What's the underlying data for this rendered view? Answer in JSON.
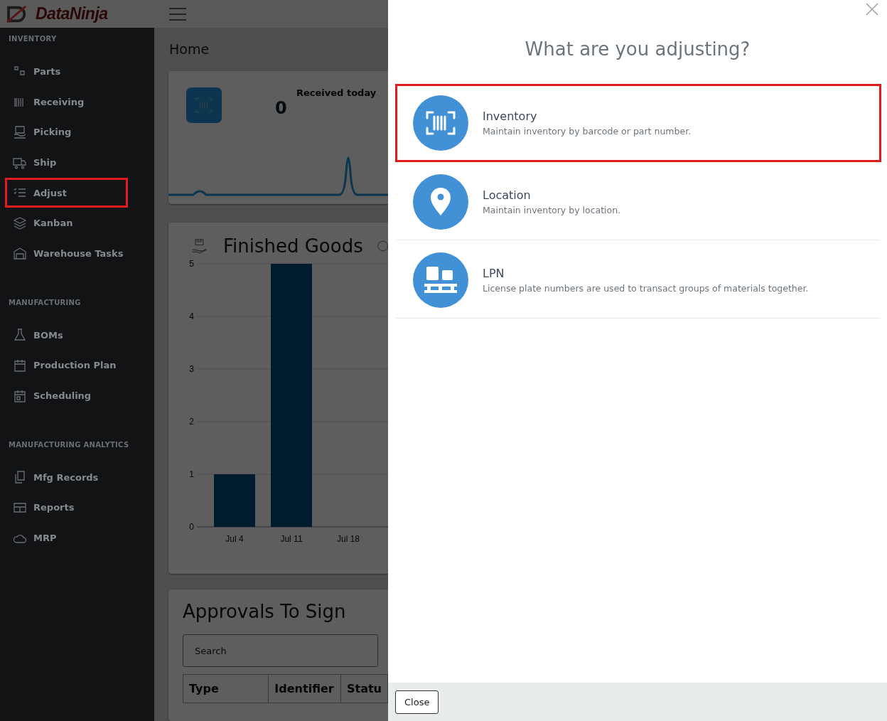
{
  "brand": {
    "name_part_1": "Data",
    "name_part_2": "Ninja"
  },
  "sidebar": {
    "sections": [
      {
        "title": "INVENTORY",
        "items": [
          {
            "label": "Parts",
            "highlighted": false
          },
          {
            "label": "Receiving",
            "highlighted": false
          },
          {
            "label": "Picking",
            "highlighted": false
          },
          {
            "label": "Ship",
            "highlighted": false
          },
          {
            "label": "Adjust",
            "highlighted": true
          },
          {
            "label": "Kanban",
            "highlighted": false
          },
          {
            "label": "Warehouse Tasks",
            "highlighted": false
          }
        ]
      },
      {
        "title": "MANUFACTURING",
        "items": [
          {
            "label": "BOMs",
            "highlighted": false
          },
          {
            "label": "Production Plan",
            "highlighted": false
          },
          {
            "label": "Scheduling",
            "highlighted": false
          }
        ]
      },
      {
        "title": "MANUFACTURING ANALYTICS",
        "items": [
          {
            "label": "Mfg Records",
            "highlighted": false
          },
          {
            "label": "Reports",
            "highlighted": false
          },
          {
            "label": "MRP",
            "highlighted": false
          }
        ]
      }
    ]
  },
  "page_title": "Home",
  "received_card": {
    "label": "Received today",
    "value": "0"
  },
  "finished_goods": {
    "title": "Finished Goods",
    "chart_data": {
      "type": "bar",
      "categories": [
        "Jul 4",
        "Jul 11",
        "Jul 18"
      ],
      "series": [
        {
          "color": "#001a2e",
          "values": [
            1,
            5,
            0
          ]
        }
      ],
      "grid": true,
      "ylim": [
        0,
        5
      ],
      "yticks": [
        0,
        1,
        2,
        3,
        4,
        5
      ]
    }
  },
  "approvals": {
    "title": "Approvals To Sign",
    "search": {
      "placeholder": "Search"
    },
    "columns": [
      "Type",
      "Identifier",
      "Statu"
    ]
  },
  "modal": {
    "title": "What are you adjusting?",
    "options": [
      {
        "kind": "barcode",
        "title": "Inventory",
        "description": "Maintain inventory by barcode or part number.",
        "highlighted": true
      },
      {
        "kind": "location",
        "title": "Location",
        "description": "Maintain inventory by location.",
        "highlighted": false
      },
      {
        "kind": "pallet",
        "title": "LPN",
        "description": "License plate numbers are used to transact groups of materials together.",
        "highlighted": false
      }
    ],
    "close_button": "Close"
  }
}
